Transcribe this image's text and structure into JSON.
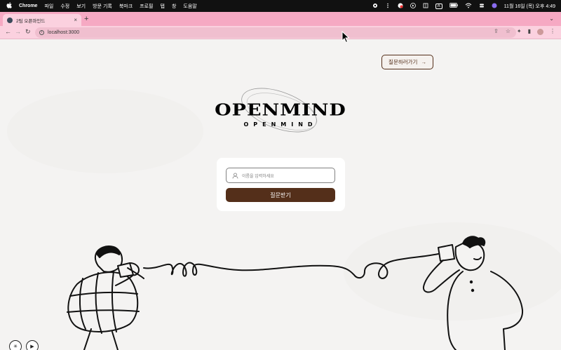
{
  "menubar": {
    "app_name": "Chrome",
    "menus": [
      "파일",
      "수정",
      "보기",
      "방문 기록",
      "북마크",
      "프로필",
      "탭",
      "창",
      "도움말"
    ],
    "clock": "11월 16일 (목) 오후 4:49",
    "input_badge": "A"
  },
  "browser": {
    "tab_title": "2팀 오픈마인드",
    "tab_close": "×",
    "new_tab": "+",
    "url": "localhost:3000"
  },
  "page": {
    "ask_button_label": "질문하러가기",
    "ask_button_arrow": "→",
    "logo_text": "OPENMIND",
    "logo_subtext": "OPENMIND",
    "name_placeholder": "이름을 입력하세요",
    "submit_label": "질문받기"
  },
  "colors": {
    "brand_brown": "#542f1a",
    "tab_pink": "#f6a9c3",
    "toolbar_pink": "#fbd1df",
    "background": "#f4f3f2"
  },
  "icons": {
    "apple": "apple-icon",
    "info": "info-icon",
    "person": "person-icon",
    "arrow_right": "arrow-right-icon"
  }
}
